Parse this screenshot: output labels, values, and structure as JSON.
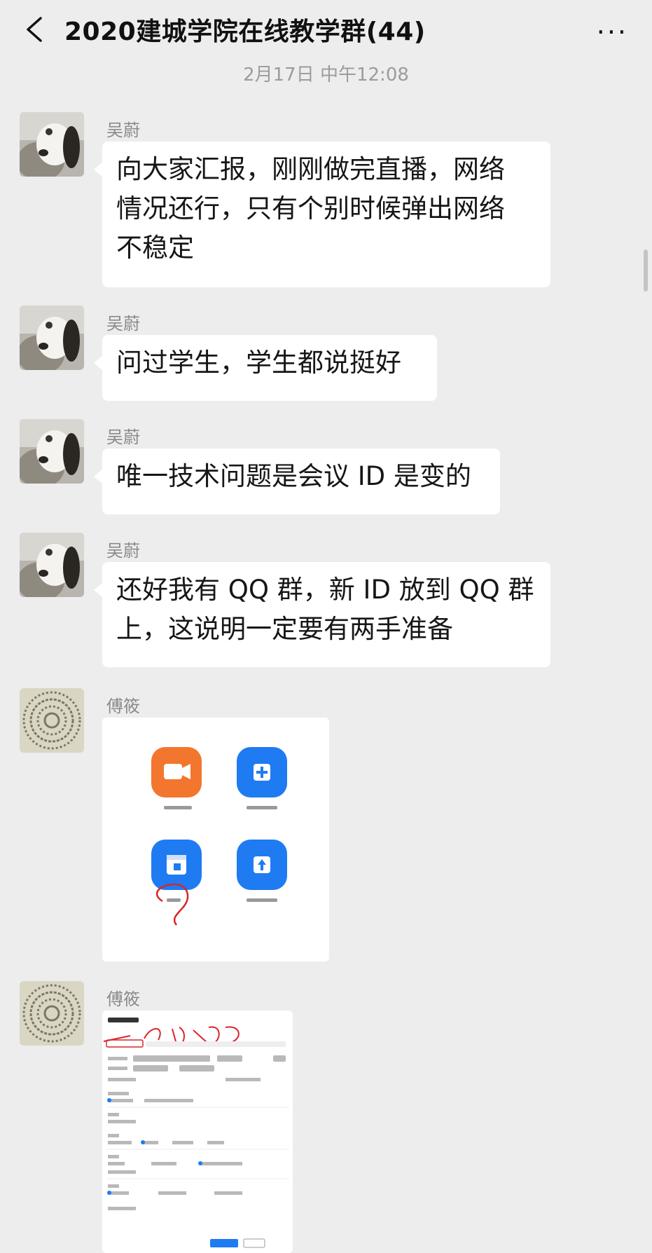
{
  "header": {
    "title": "2020建城学院在线教学群(44)",
    "more": "···"
  },
  "timestamp": "2月17日 中午12:08",
  "messages": [
    {
      "sender": "吴蔚",
      "text_lines": [
        "向大家汇报，刚刚做完直播，网络",
        "情况还行，只有个别时候弹出网络",
        "不稳定"
      ]
    },
    {
      "sender": "吴蔚",
      "text_lines": [
        "问过学生，学生都说挺好"
      ]
    },
    {
      "sender": "吴蔚",
      "text_lines": [
        "唯一技术问题是会议 ID 是变的"
      ]
    },
    {
      "sender": "吴蔚",
      "text_lines": [
        "还好我有 QQ 群，新 ID 放到 QQ 群",
        "上，这说明一定要有两手准备"
      ]
    },
    {
      "sender": "傅筱",
      "image": "zoom-app-home-screenshot"
    },
    {
      "sender": "傅筱",
      "image": "schedule-meeting-form-screenshot"
    }
  ],
  "colors": {
    "zoom_orange": "#f2762e",
    "zoom_blue": "#1f7bf2",
    "annotation_red": "#d8262b"
  }
}
